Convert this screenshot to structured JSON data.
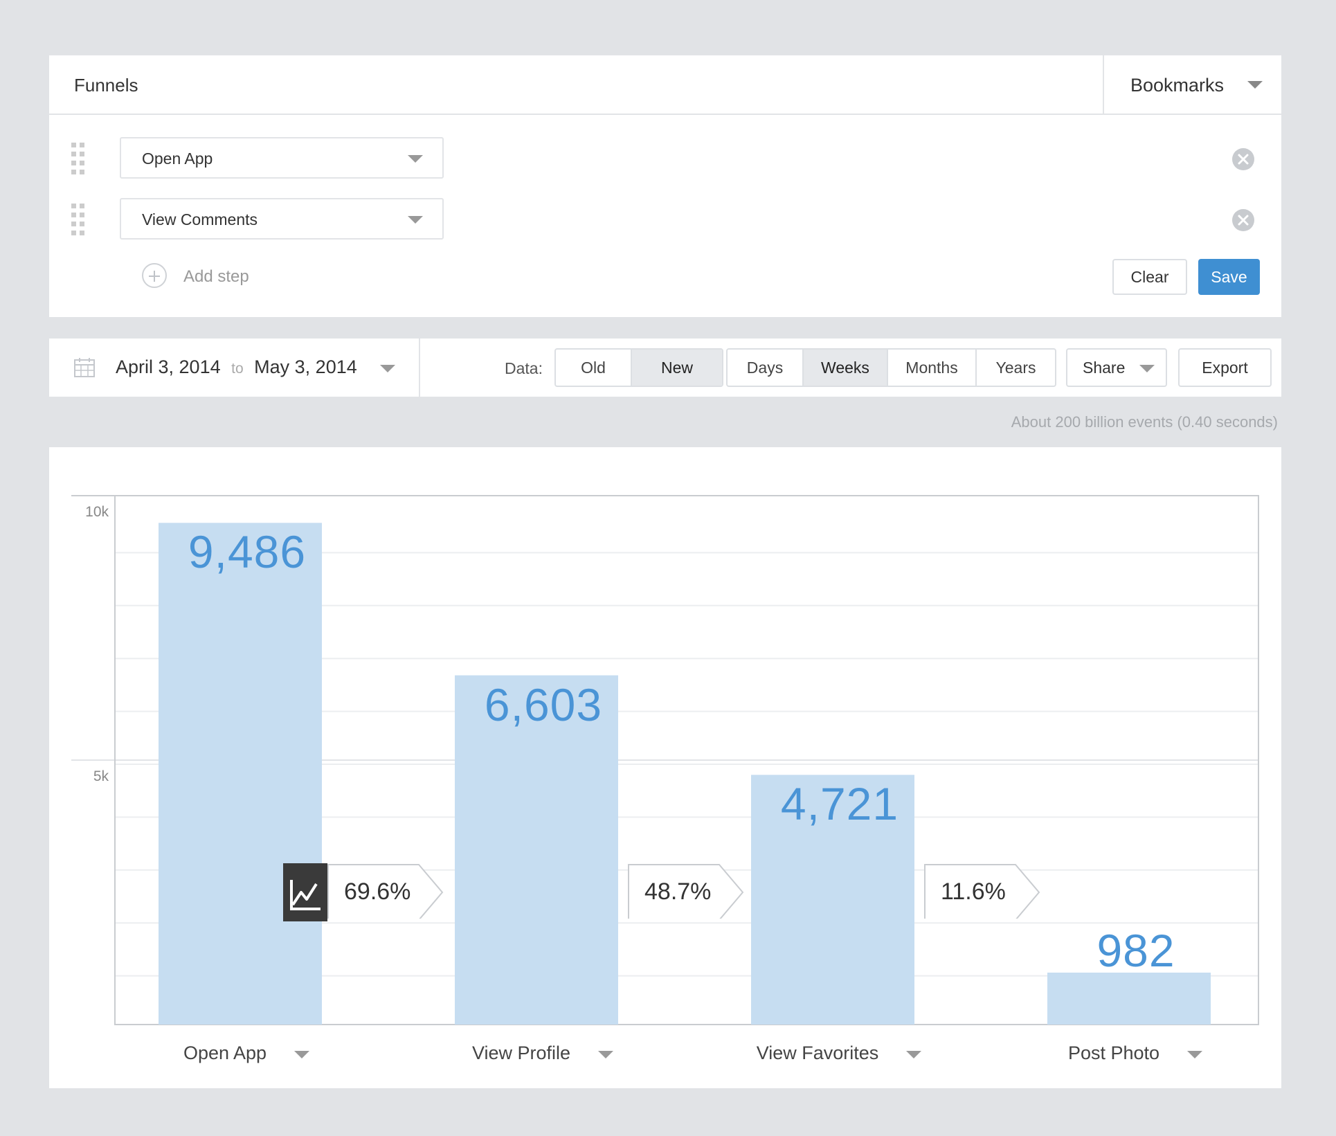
{
  "editor": {
    "title": "Funnels",
    "bookmarks_label": "Bookmarks",
    "steps": [
      {
        "label": "Open App"
      },
      {
        "label": "View Comments"
      }
    ],
    "add_step_label": "Add step",
    "clear_label": "Clear",
    "save_label": "Save"
  },
  "controls": {
    "date_from": "April 3, 2014",
    "date_to_word": "to",
    "date_to": "May 3, 2014",
    "data_label": "Data:",
    "data_options": [
      "Old",
      "New"
    ],
    "data_selected": "New",
    "interval_options": [
      "Days",
      "Weeks",
      "Months",
      "Years"
    ],
    "interval_selected": "Weeks",
    "share_label": "Share",
    "export_label": "Export"
  },
  "meta_text": "About 200 billion events (0.40 seconds)",
  "colors": {
    "bar": "#c6ddf1",
    "bar_value": "#4a94d6",
    "primary_button": "#3f8fd2"
  },
  "chart_data": {
    "type": "bar",
    "categories": [
      "Open App",
      "View Profile",
      "View Favorites",
      "Post Photo"
    ],
    "values": [
      9486,
      6603,
      4721,
      982
    ],
    "value_labels": [
      "9,486",
      "6,603",
      "4,721",
      "982"
    ],
    "conversion_rates": [
      "69.6%",
      "48.7%",
      "11.6%"
    ],
    "yticks": [
      {
        "value": 10000,
        "label": "10k"
      },
      {
        "value": 5000,
        "label": "5k"
      }
    ],
    "ylim": [
      0,
      10000
    ],
    "grid": true
  }
}
